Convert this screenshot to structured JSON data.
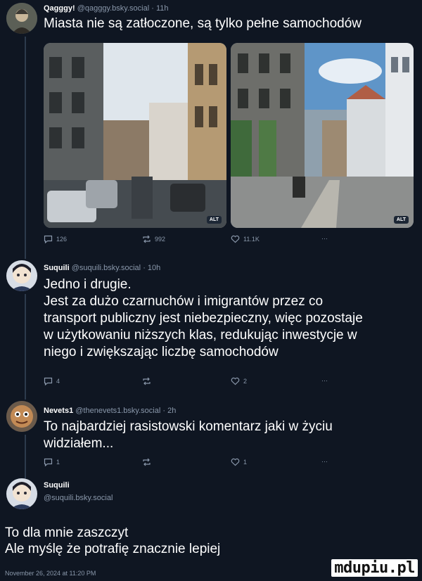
{
  "posts": [
    {
      "name": "Qagggy!",
      "handle": "@qagggy.bsky.social",
      "time": "· 11h",
      "text": "Miasta nie są zatłoczone, są tylko pełne samochodów",
      "images": [
        {
          "alt_badge": "ALT"
        },
        {
          "alt_badge": "ALT"
        }
      ],
      "actions": {
        "replies": "126",
        "reposts": "992",
        "likes": "11.1K",
        "more": "···"
      }
    },
    {
      "name": "Suquili",
      "handle": "@suquili.bsky.social",
      "time": "· 10h",
      "text": "Jedno i drugie.\nJest za dużo czarnuchów i imigrantów przez co\ntransport publiczny jest niebezpieczny, więc pozostaje\nw użytkowaniu niższych klas, redukując inwestycje w\nniego i zwiększając liczbę samochodów",
      "actions": {
        "replies": "4",
        "reposts": "",
        "likes": "2",
        "more": "···"
      }
    },
    {
      "name": "Nevets1",
      "handle": "@thenevets1.bsky.social",
      "time": "· 2h",
      "text": "To najbardziej rasistowski komentarz jaki w życiu\nwidziałem...",
      "actions": {
        "replies": "1",
        "reposts": "",
        "likes": "1",
        "more": "···"
      }
    },
    {
      "name": "Suquili",
      "handle": "@suquili.bsky.social",
      "text": "To dla mnie zaszczyt\nAle myślę że potrafię znacznie lepiej",
      "date": "November 26, 2024 at 11:20 PM"
    }
  ],
  "watermark": "mdupiu.pl",
  "colors": {
    "background": "#0f1622",
    "muted": "#8a98ab",
    "thread_line": "#2c3a4c"
  }
}
